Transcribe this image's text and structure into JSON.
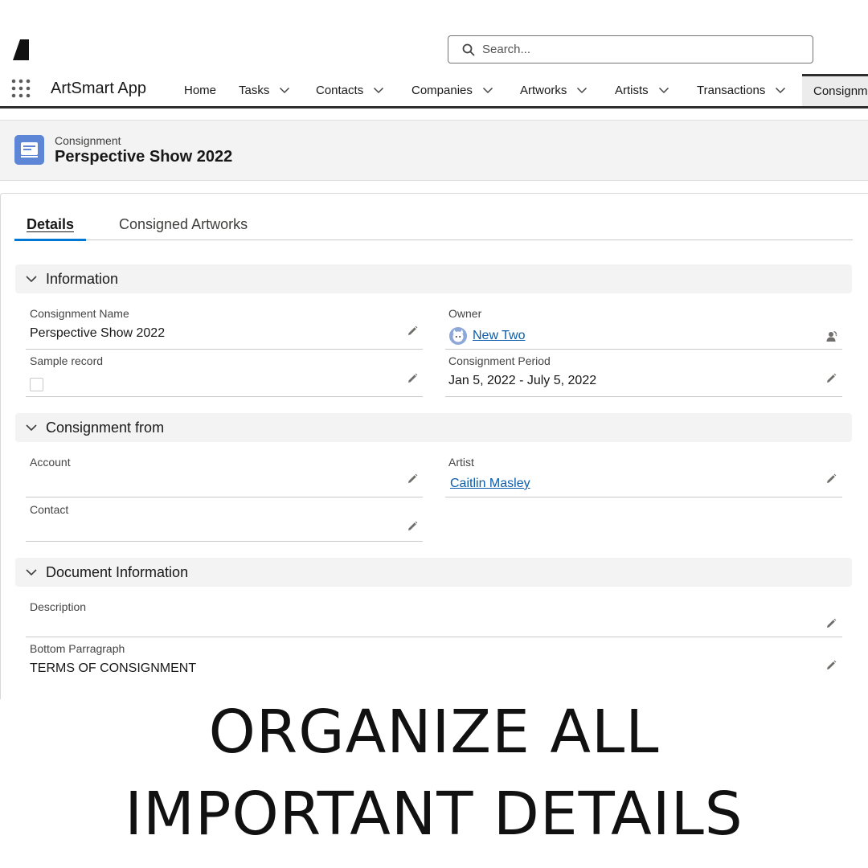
{
  "search": {
    "placeholder": "Search..."
  },
  "nav": {
    "app_name": "ArtSmart App",
    "items": [
      {
        "label": "Home"
      },
      {
        "label": "Tasks"
      },
      {
        "label": "Contacts"
      },
      {
        "label": "Companies"
      },
      {
        "label": "Artworks"
      },
      {
        "label": "Artists"
      },
      {
        "label": "Transactions"
      },
      {
        "label": "Consignm"
      }
    ]
  },
  "record": {
    "type": "Consignment",
    "name": "Perspective Show 2022"
  },
  "tabs": [
    {
      "label": "Details"
    },
    {
      "label": "Consigned Artworks"
    }
  ],
  "sections": {
    "information": {
      "title": "Information",
      "consignment_name_label": "Consignment Name",
      "consignment_name_value": "Perspective Show 2022",
      "owner_label": "Owner",
      "owner_value": "New Two",
      "sample_record_label": "Sample record",
      "sample_record_checked": false,
      "consignment_period_label": "Consignment Period",
      "consignment_period_value": "Jan 5, 2022 - July 5, 2022"
    },
    "consignment_from": {
      "title": "Consignment from",
      "account_label": "Account",
      "account_value": "",
      "artist_label": "Artist",
      "artist_value": "Caitlin Masley",
      "contact_label": "Contact",
      "contact_value": ""
    },
    "document_information": {
      "title": "Document Information",
      "description_label": "Description",
      "description_value": "",
      "bottom_paragraph_label": "Bottom Parragraph",
      "bottom_paragraph_value": "TERMS OF CONSIGNMENT"
    }
  },
  "tagline": {
    "line1": "ORGANIZE ALL",
    "line2": "IMPORTANT DETAILS"
  },
  "colors": {
    "accent": "#0176d3",
    "link": "#0b5cab",
    "record_icon": "#5e86d6"
  }
}
